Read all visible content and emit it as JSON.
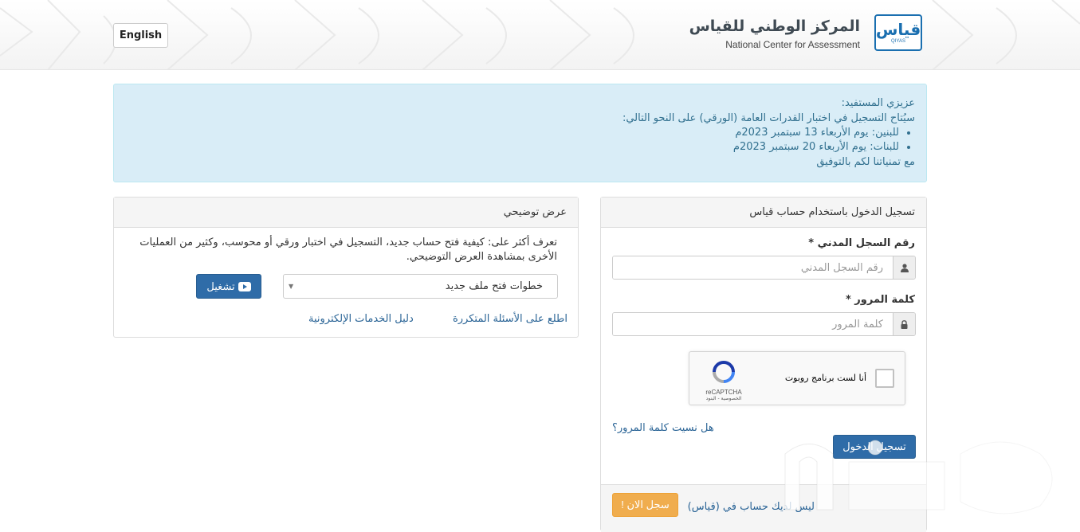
{
  "header": {
    "language_button": "English",
    "logo": {
      "arabic_name": "المركز الوطني للقياس",
      "english_name": "National Center for Assessment",
      "mark_glyph": "قياس",
      "mark_sub": "QIYAS"
    }
  },
  "notice": {
    "greeting": "عزيزي المستفيد:",
    "intro": "سيُتاح التسجيل في اختبار القدرات العامة (الورقي) على النحو التالي:",
    "items": [
      "للبنين: يوم الأربعاء 13 سبتمبر 2023م",
      "للبنات: يوم الأربعاء 20 سبتمبر 2023م"
    ],
    "closing": "مع تمنياتنا لكم بالتوفيق"
  },
  "login": {
    "heading": "تسجيل الدخول باستخدام حساب قياس",
    "id_label": "رقم السجل المدني *",
    "id_placeholder": "رقم السجل المدني",
    "password_label": "كلمة المرور *",
    "password_placeholder": "كلمة المرور",
    "recaptcha": {
      "checkbox_text": "أنا لست برنامج روبوت",
      "brand": "reCAPTCHA",
      "terms": "الخصوصية - البنود"
    },
    "forgot_password": "هل نسيت كلمة المرور؟",
    "login_button": "تسجيل الدخول",
    "no_account_text": "ليس لديك حساب في (قياس)",
    "register_button": "سجل الان !"
  },
  "demo": {
    "heading": "عرض توضيحي",
    "description": "تعرف أكثر على: كيفية فتح حساب جديد، التسجيل في اختبار ورقي أو محوسب، وكثير من العمليات الأخرى بمشاهدة العرض التوضيحي.",
    "select_value": "خطوات فتح ملف جديد",
    "play_button": "تشغيل",
    "faq_link": "اطلع على الأسئلة المتكررة",
    "guide_link": "دليل الخدمات الإلكترونية"
  },
  "colors": {
    "primary": "#2f6ca8",
    "warning": "#f0ad4e",
    "info_bg": "#d9edf7",
    "info_text": "#31708f",
    "link": "#2a6496"
  }
}
